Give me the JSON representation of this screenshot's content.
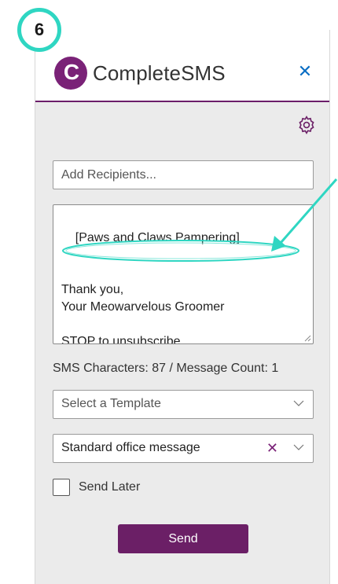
{
  "step_badge": {
    "number": "6"
  },
  "header": {
    "logo_letter": "C",
    "app_title": "CompleteSMS",
    "close_glyph": "✕"
  },
  "settings": {
    "icon": "gear-icon"
  },
  "recipients": {
    "placeholder": "Add Recipients..."
  },
  "message": {
    "text": "[Paws and Claws Pampering]\n\n\nThank you,\nYour Meowarvelous Groomer\n\nSTOP to unsubscribe"
  },
  "sms_info": {
    "text": "SMS Characters: 87 / Message Count: 1"
  },
  "template_select": {
    "placeholder": "Select a Template"
  },
  "office_select": {
    "value": "Standard office message",
    "clear_glyph": "✕"
  },
  "send_later": {
    "label": "Send Later",
    "checked": false
  },
  "send_button": {
    "label": "Send"
  },
  "colors": {
    "brand_purple": "#6b1f66",
    "annotation_teal": "#2fd6c2",
    "close_blue": "#0b6ec4"
  }
}
